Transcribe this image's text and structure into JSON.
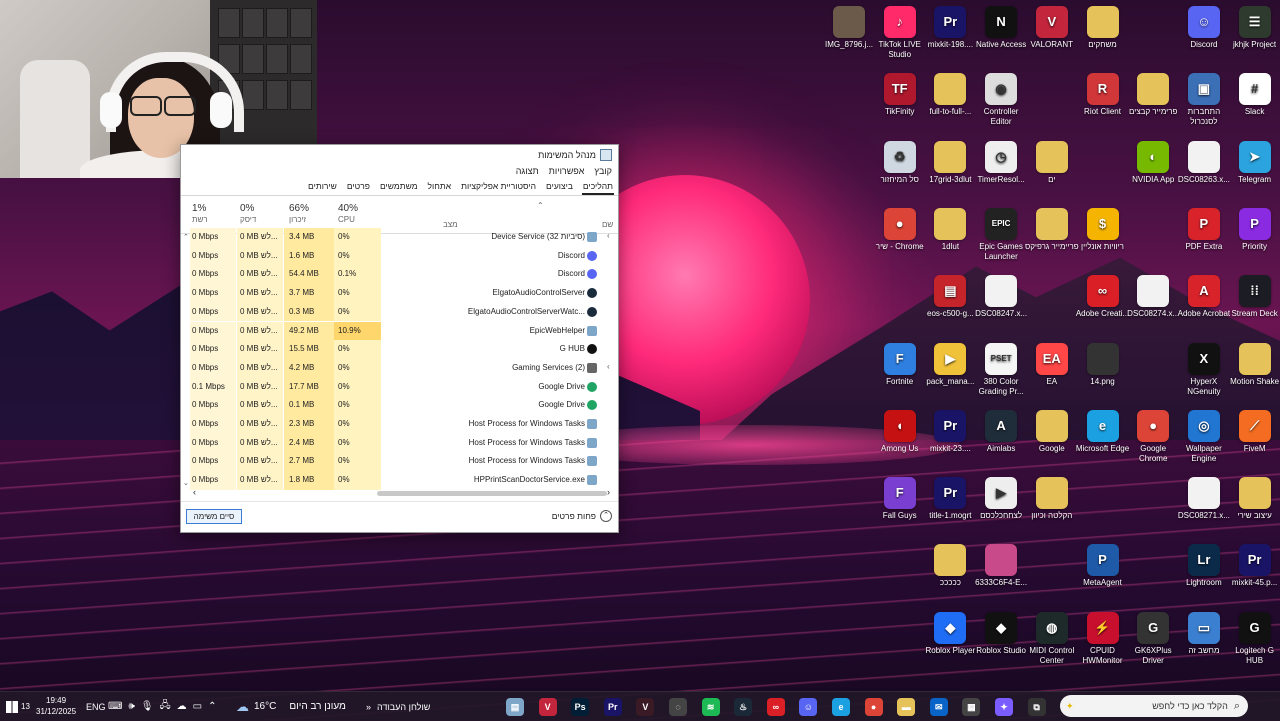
{
  "taskmanager": {
    "title": "מנהל המשימות",
    "close_glyph": "✕",
    "menu": [
      "קובץ",
      "אפשרויות",
      "תצוגה"
    ],
    "tabs": [
      "תהליכים",
      "ביצועים",
      "היסטוריית אפליקציות",
      "אתחול",
      "משתמשים",
      "פרטים",
      "שירותים"
    ],
    "sort_glyph": "⌃",
    "columns": {
      "name": "שם",
      "status": "מצב",
      "cpu": {
        "pct": "40%",
        "label": "CPU"
      },
      "memory": {
        "pct": "66%",
        "label": "זיכרון"
      },
      "disk": {
        "pct": "0%",
        "label": "דיסק"
      },
      "network": {
        "pct": "1%",
        "label": "רשת"
      }
    },
    "rows": [
      {
        "name": "Device Service (32 סיביות)",
        "cpu": "0%",
        "mem": "3.4 MB",
        "disk": "0 MB לש...",
        "net": "0 Mbps",
        "icon": "window-icon",
        "expand": true,
        "hot": false
      },
      {
        "name": "Discord",
        "cpu": "0%",
        "mem": "1.6 MB",
        "disk": "0 MB לש...",
        "net": "0 Mbps",
        "icon": "discord-icon",
        "expand": false,
        "hot": false
      },
      {
        "name": "Discord",
        "cpu": "0.1%",
        "mem": "54.4 MB",
        "disk": "0 MB לש...",
        "net": "0 Mbps",
        "icon": "discord-icon",
        "expand": false,
        "hot": false
      },
      {
        "name": "ElgatoAudioControlServer",
        "cpu": "0%",
        "mem": "3.7 MB",
        "disk": "0 MB לש...",
        "net": "0 Mbps",
        "icon": "elgato-icon",
        "expand": false,
        "hot": false
      },
      {
        "name": "ElgatoAudioControlServerWatc...",
        "cpu": "0%",
        "mem": "0.3 MB",
        "disk": "0 MB לש...",
        "net": "0 Mbps",
        "icon": "elgato-icon",
        "expand": false,
        "hot": false
      },
      {
        "name": "EpicWebHelper",
        "cpu": "10.9%",
        "mem": "49.2 MB",
        "disk": "0 MB לש...",
        "net": "0 Mbps",
        "icon": "window-icon",
        "expand": false,
        "hot": true
      },
      {
        "name": "G HUB",
        "cpu": "0%",
        "mem": "15.5 MB",
        "disk": "0 MB לש...",
        "net": "0 Mbps",
        "icon": "ghub-icon",
        "expand": false,
        "hot": false
      },
      {
        "name": "Gaming Services (2)",
        "cpu": "0%",
        "mem": "4.2 MB",
        "disk": "0 MB לש...",
        "net": "0 Mbps",
        "icon": "gear-box-icon",
        "expand": true,
        "hot": false
      },
      {
        "name": "Google Drive",
        "cpu": "0%",
        "mem": "17.7 MB",
        "disk": "0 MB לש...",
        "net": "0.1 Mbps",
        "icon": "drive-icon",
        "expand": false,
        "hot": false
      },
      {
        "name": "Google Drive",
        "cpu": "0%",
        "mem": "0.1 MB",
        "disk": "0 MB לש...",
        "net": "0 Mbps",
        "icon": "drive-icon",
        "expand": false,
        "hot": false
      },
      {
        "name": "Host Process for Windows Tasks",
        "cpu": "0%",
        "mem": "2.3 MB",
        "disk": "0 MB לש...",
        "net": "0 Mbps",
        "icon": "window-icon",
        "expand": false,
        "hot": false
      },
      {
        "name": "Host Process for Windows Tasks",
        "cpu": "0%",
        "mem": "2.4 MB",
        "disk": "0 MB לש...",
        "net": "0 Mbps",
        "icon": "window-icon",
        "expand": false,
        "hot": false
      },
      {
        "name": "Host Process for Windows Tasks",
        "cpu": "0%",
        "mem": "2.7 MB",
        "disk": "0 MB לש...",
        "net": "0 Mbps",
        "icon": "window-icon",
        "expand": false,
        "hot": false
      },
      {
        "name": "HPPrintScanDoctorService.exe",
        "cpu": "0%",
        "mem": "1.8 MB",
        "disk": "0 MB לש...",
        "net": "0 Mbps",
        "icon": "window-icon",
        "expand": false,
        "hot": false
      }
    ],
    "end_task": "סיים משימה",
    "fewer_details": "פחות פרטים",
    "fewer_glyph": "⌃",
    "scroll_up": "⌃",
    "scroll_down": "⌄",
    "scroll_left": "‹",
    "scroll_right": "›",
    "expand_glyph": "‹"
  },
  "desktop_icons": [
    {
      "label": "IMG_8796.j...",
      "icon": "photo-icon",
      "color": "#6b5a4a",
      "glyph": ""
    },
    {
      "label": "TikTok LIVE Studio",
      "icon": "tiktok-icon",
      "color": "#ff2a6a",
      "glyph": "♪"
    },
    {
      "label": "mixkit-198....",
      "icon": "premiere-icon",
      "color": "#1a1466",
      "glyph": "Pr"
    },
    {
      "label": "Native Access",
      "icon": "native-access-icon",
      "color": "#111111",
      "glyph": "N"
    },
    {
      "label": "VALORANT",
      "icon": "valorant-icon",
      "color": "#c2253c",
      "glyph": "V"
    },
    {
      "label": "משחקים",
      "icon": "folder-icon",
      "color": "#e6c25a",
      "glyph": ""
    },
    {
      "label": "Discord",
      "icon": "discord-icon",
      "color": "#5865f2",
      "glyph": "☺"
    },
    {
      "label": "jkhjk Project",
      "icon": "project-icon",
      "color": "#2e3a2e",
      "glyph": "☰"
    },
    {
      "label": "TikFinity",
      "icon": "tikfinity-icon",
      "color": "#b0182e",
      "glyph": "TF"
    },
    {
      "label": "full-to-full-...",
      "icon": "folder-icon",
      "color": "#e6c25a",
      "glyph": ""
    },
    {
      "label": "Controller Editor",
      "icon": "controller-icon",
      "color": "#dddddd",
      "glyph": "◉"
    },
    {
      "label": "Riot Client",
      "icon": "riot-icon",
      "color": "#d13639",
      "glyph": "R"
    },
    {
      "label": "פרימייר קבצים",
      "icon": "folder-icon",
      "color": "#e6c25a",
      "glyph": ""
    },
    {
      "label": "התחברות לסנכרול",
      "icon": "computer-icon",
      "color": "#3b6fb6",
      "glyph": "▣"
    },
    {
      "label": "Slack",
      "icon": "slack-icon",
      "color": "#ffffff",
      "glyph": "#"
    },
    {
      "label": "סל המיחזור",
      "icon": "recycle-bin-icon",
      "color": "#cfd8e0",
      "glyph": "♻"
    },
    {
      "label": "17grid-3dlut",
      "icon": "folder-icon",
      "color": "#e6c25a",
      "glyph": ""
    },
    {
      "label": "TimerResol...",
      "icon": "clock-icon",
      "color": "#eeeeee",
      "glyph": "◷"
    },
    {
      "label": "ים",
      "icon": "folder-icon",
      "color": "#e6c25a",
      "glyph": ""
    },
    {
      "label": "NVIDIA App",
      "icon": "nvidia-icon",
      "color": "#76b900",
      "glyph": "◐"
    },
    {
      "label": "DSC08263.x...",
      "icon": "file-icon",
      "color": "#f2f2f2",
      "glyph": ""
    },
    {
      "label": "Telegram",
      "icon": "telegram-icon",
      "color": "#2aa3de",
      "glyph": "➤"
    },
    {
      "label": "שיר - Chrome",
      "icon": "chrome-icon",
      "color": "#db4437",
      "glyph": "●"
    },
    {
      "label": "1dlut",
      "icon": "folder-icon",
      "color": "#e6c25a",
      "glyph": ""
    },
    {
      "label": "Epic Games Launcher",
      "icon": "epic-icon",
      "color": "#222222",
      "glyph": "EPIC"
    },
    {
      "label": "פריימייר גרפיקס",
      "icon": "folder-icon",
      "color": "#e6c25a",
      "glyph": ""
    },
    {
      "label": "ריוויות אונליין",
      "icon": "coin-icon",
      "color": "#f5b400",
      "glyph": "$"
    },
    {
      "label": "PDF Extra",
      "icon": "pdf-icon",
      "color": "#d8232a",
      "glyph": "P"
    },
    {
      "label": "Priority",
      "icon": "priority-icon",
      "color": "#8a2be2",
      "glyph": "P"
    },
    {
      "label": "eos-c500-g...",
      "icon": "archive-icon",
      "color": "#c6242b",
      "glyph": "▤"
    },
    {
      "label": "DSC08247.x...",
      "icon": "file-icon",
      "color": "#f2f2f2",
      "glyph": ""
    },
    {
      "label": "Adobe Creati...",
      "icon": "creative-cloud-icon",
      "color": "#da1f26",
      "glyph": "∞"
    },
    {
      "label": "DSC08274.x...",
      "icon": "file-icon",
      "color": "#f2f2f2",
      "glyph": ""
    },
    {
      "label": "Adobe Acrobat",
      "icon": "acrobat-icon",
      "color": "#d8232a",
      "glyph": "A"
    },
    {
      "label": "Stream Deck",
      "icon": "stream-deck-icon",
      "color": "#1c1c24",
      "glyph": "⁞⁞"
    },
    {
      "label": "Fortnite",
      "icon": "fortnite-icon",
      "color": "#2f7fe0",
      "glyph": "F"
    },
    {
      "label": "pack_mana...",
      "icon": "video-file-icon",
      "color": "#f0c23a",
      "glyph": "▶"
    },
    {
      "label": "380 Color Grading Pr...",
      "icon": "preset-icon",
      "color": "#f5f5f5",
      "glyph": "PSET"
    },
    {
      "label": "EA",
      "icon": "ea-icon",
      "color": "#ff4747",
      "glyph": "EA"
    },
    {
      "label": "14.png",
      "icon": "image-file-icon",
      "color": "#333333",
      "glyph": ""
    },
    {
      "label": "HyperX NGenuity",
      "icon": "hyperx-icon",
      "color": "#111111",
      "glyph": "X"
    },
    {
      "label": "Motion Shake",
      "icon": "folder-icon",
      "color": "#e6c25a",
      "glyph": ""
    },
    {
      "label": "Among Us",
      "icon": "among-us-icon",
      "color": "#c51111",
      "glyph": "◖"
    },
    {
      "label": "mixkit-23....",
      "icon": "premiere-icon",
      "color": "#1a1466",
      "glyph": "Pr"
    },
    {
      "label": "Aimlabs",
      "icon": "aimlabs-icon",
      "color": "#1f2c3a",
      "glyph": "A"
    },
    {
      "label": "Google",
      "icon": "folder-icon",
      "color": "#e6c25a",
      "glyph": ""
    },
    {
      "label": "Microsoft Edge",
      "icon": "edge-icon",
      "color": "#1ba1e2",
      "glyph": "e"
    },
    {
      "label": "Google Chrome",
      "icon": "chrome-icon",
      "color": "#db4437",
      "glyph": "●"
    },
    {
      "label": "Wallpaper Engine",
      "icon": "wallpaper-engine-icon",
      "color": "#2176d2",
      "glyph": "◎"
    },
    {
      "label": "FiveM",
      "icon": "fivem-icon",
      "color": "#f36c21",
      "glyph": "⟋"
    },
    {
      "label": "Fall Guys",
      "icon": "fall-guys-icon",
      "color": "#7a3fd1",
      "glyph": "F"
    },
    {
      "label": "title-1.mogrt",
      "icon": "premiere-icon",
      "color": "#1a1466",
      "glyph": "Pr"
    },
    {
      "label": "לצחחכלכסם",
      "icon": "media-icon",
      "color": "#eeeeee",
      "glyph": "▶"
    },
    {
      "label": "הקלטה וכיוון",
      "icon": "folder-icon",
      "color": "#e6c25a",
      "glyph": ""
    },
    {
      "label": "DSC08271.x...",
      "icon": "file-icon",
      "color": "#f2f2f2",
      "glyph": ""
    },
    {
      "label": "עיצוב שירי",
      "icon": "folder-icon",
      "color": "#e6c25a",
      "glyph": ""
    },
    {
      "label": "כככככ",
      "icon": "folder-icon",
      "color": "#e6c25a",
      "glyph": ""
    },
    {
      "label": "6333C6F4-E...",
      "icon": "photo-icon",
      "color": "#c94a8a",
      "glyph": ""
    },
    {
      "label": "MetaAgent",
      "icon": "metaagent-icon",
      "color": "#1e5aa8",
      "glyph": "P"
    },
    {
      "label": "Lightroom",
      "icon": "lightroom-icon",
      "color": "#0b2a4a",
      "glyph": "Lr"
    },
    {
      "label": "mixkit-45.p...",
      "icon": "premiere-project-icon",
      "color": "#1a1466",
      "glyph": "Pr"
    },
    {
      "label": "Roblox Player",
      "icon": "roblox-icon",
      "color": "#1f6cf5",
      "glyph": "◆"
    },
    {
      "label": "Roblox Studio",
      "icon": "roblox-studio-icon",
      "color": "#111111",
      "glyph": "◆"
    },
    {
      "label": "MIDI Control Center",
      "icon": "midi-icon",
      "color": "#1e2a2a",
      "glyph": "◍"
    },
    {
      "label": "CPUID HWMonitor",
      "icon": "hwmonitor-icon",
      "color": "#c8102e",
      "glyph": "⚡"
    },
    {
      "label": "GK6XPlus Driver",
      "icon": "keyboard-driver-icon",
      "color": "#333333",
      "glyph": "G"
    },
    {
      "label": "מחשב זה",
      "icon": "this-pc-icon",
      "color": "#3b7fd0",
      "glyph": "▭"
    },
    {
      "label": "Logitech G HUB",
      "icon": "ghub-icon",
      "color": "#111111",
      "glyph": "G"
    }
  ],
  "taskbar": {
    "start_badge": "13",
    "clock_time": "19:49",
    "clock_date": "31/12/2025",
    "language": "ENG",
    "weather_temp": "16°C",
    "weather_text": "מעונן רב היום",
    "desktop_label": "שולחן העבודה",
    "search_placeholder": "הקלד כאן כדי לחפש",
    "apps": [
      {
        "name": "task-manager-icon",
        "color": "#7ea6c9",
        "glyph": "▤"
      },
      {
        "name": "valorant-tray-icon",
        "color": "#c2253c",
        "glyph": "V"
      },
      {
        "name": "photoshop-icon",
        "color": "#001e36",
        "glyph": "Ps"
      },
      {
        "name": "premiere-taskbar-icon",
        "color": "#1a1466",
        "glyph": "Pr"
      },
      {
        "name": "valorant-taskbar-icon",
        "color": "#3a1a24",
        "glyph": "V"
      },
      {
        "name": "chatgpt-icon",
        "color": "#444444",
        "glyph": "◌"
      },
      {
        "name": "spotify-icon",
        "color": "#1db954",
        "glyph": "≋"
      },
      {
        "name": "steam-icon",
        "color": "#1b2838",
        "glyph": "♨"
      },
      {
        "name": "creative-cloud-taskbar-icon",
        "color": "#da1f26",
        "glyph": "∞"
      },
      {
        "name": "discord-taskbar-icon",
        "color": "#5865f2",
        "glyph": "☺"
      },
      {
        "name": "edge-taskbar-icon",
        "color": "#1ba1e2",
        "glyph": "e"
      },
      {
        "name": "chrome-taskbar-icon",
        "color": "#db4437",
        "glyph": "●"
      },
      {
        "name": "file-explorer-icon",
        "color": "#e6c25a",
        "glyph": "▬"
      },
      {
        "name": "mail-icon",
        "color": "#0a64c8",
        "glyph": "✉"
      },
      {
        "name": "store-icon",
        "color": "#444444",
        "glyph": "▦"
      },
      {
        "name": "copilot-icon",
        "color": "#7a5cff",
        "glyph": "✦"
      },
      {
        "name": "task-view-icon",
        "color": "#333333",
        "glyph": "⧉"
      }
    ]
  }
}
